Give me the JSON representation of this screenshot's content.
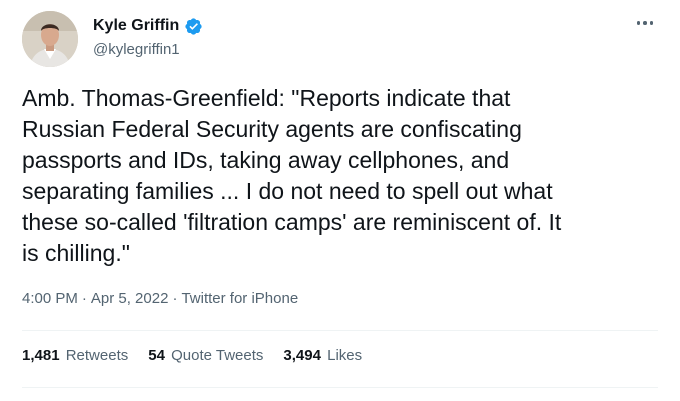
{
  "author": {
    "display_name": "Kyle Griffin",
    "handle": "@kylegriffin1",
    "verified_icon": "verified-badge-icon",
    "avatar_icon": "avatar"
  },
  "menu": {
    "more_icon": "more-options-icon"
  },
  "tweet": {
    "text_lines": [
      "Amb. Thomas-Greenfield: \"Reports indicate that",
      "Russian Federal Security agents are confiscating",
      "passports and IDs, taking away cellphones, and",
      "separating families ... I do not need to spell out what",
      "these so-called 'filtration camps' are reminiscent of. It",
      "is chilling.\""
    ]
  },
  "meta": {
    "time": "4:00 PM",
    "separator": "·",
    "date": "Apr 5, 2022",
    "source": "Twitter for iPhone"
  },
  "stats": {
    "retweets_count": "1,481",
    "retweets_label": "Retweets",
    "quote_tweets_count": "54",
    "quote_tweets_label": "Quote Tweets",
    "likes_count": "3,494",
    "likes_label": "Likes"
  },
  "colors": {
    "text": "#0f1419",
    "secondary": "#536471",
    "verified": "#1d9bf0",
    "divider": "#eff3f4"
  }
}
